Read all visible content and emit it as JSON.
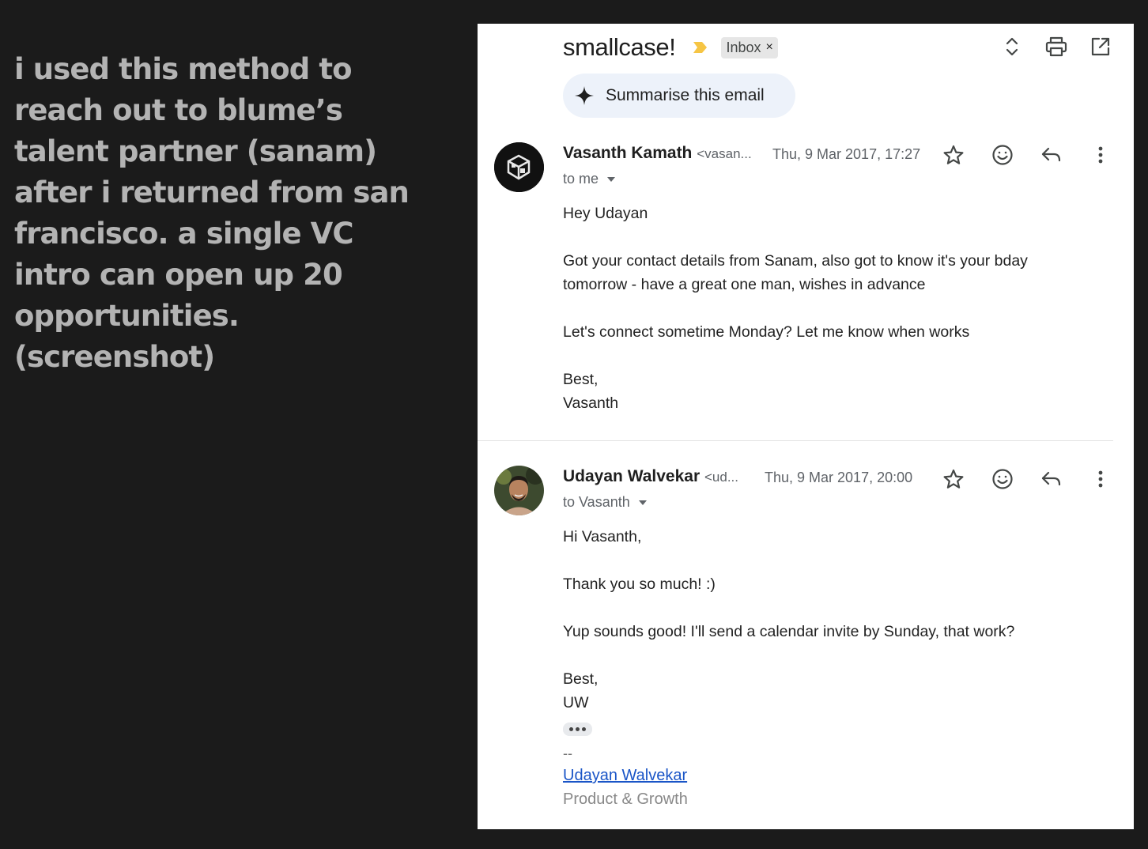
{
  "caption": {
    "lines": [
      "i used this method to",
      "reach out to blume’s",
      "talent partner (sanam)",
      "after i returned from san",
      "francisco. a single VC",
      "intro can open up 20",
      "opportunities.",
      "(screenshot)"
    ]
  },
  "header": {
    "subject": "smallcase!",
    "label": "Inbox",
    "label_remove": "×",
    "importance_color": "#f6c544",
    "icons": [
      "expand-collapse-icon",
      "print-icon",
      "open-in-new-window-icon"
    ]
  },
  "summarise": {
    "label": "Summarise this email"
  },
  "messages": [
    {
      "sender_name": "Vasanth Kamath",
      "sender_addr": "<vasan...",
      "date": "Thu, 9 Mar 2017, 17:27",
      "to": "to me",
      "body": [
        "Hey Udayan",
        "",
        "Got your contact details from Sanam, also got to know it's your bday",
        "tomorrow - have a great one man, wishes in advance",
        "",
        "Let's connect sometime Monday? Let me know when works",
        "",
        "Best,",
        "Vasanth"
      ]
    },
    {
      "sender_name": "Udayan Walvekar",
      "sender_addr": "<ud...",
      "date": "Thu, 9 Mar 2017, 20:00",
      "to": "to Vasanth",
      "body": [
        "Hi Vasanth,",
        "",
        "Thank you so much! :)",
        "",
        "Yup sounds good! I'll send a calendar invite by Sunday, that work?",
        "",
        "Best,",
        "UW"
      ],
      "signature": {
        "dash": "--",
        "name_link": "Udayan Walvekar",
        "title": "Product & Growth"
      }
    }
  ],
  "colors": {
    "page_bg": "#1b1b1b",
    "caption": "#b3b3b3",
    "summarise_bg": "#edf2fa",
    "link": "#1a55c7"
  }
}
